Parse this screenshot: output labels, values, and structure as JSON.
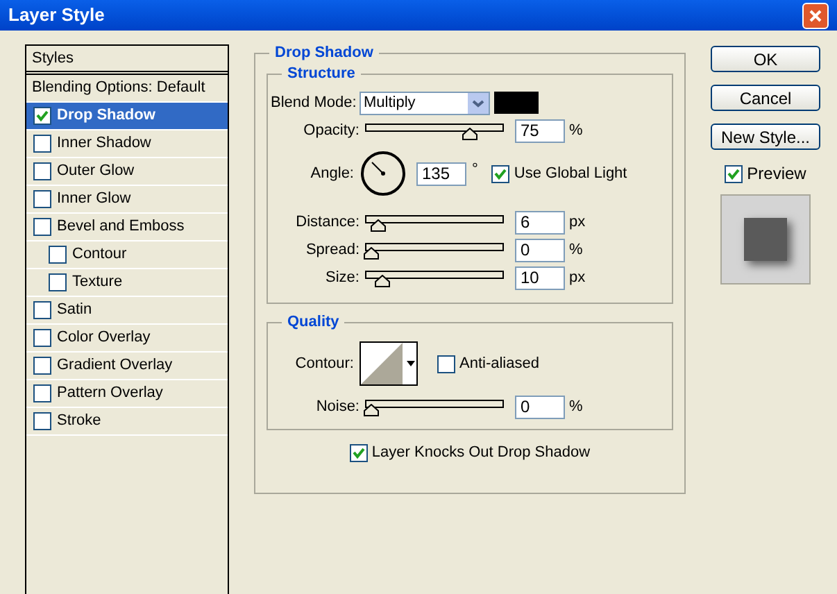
{
  "window": {
    "title": "Layer Style"
  },
  "styles_panel": {
    "header": "Styles",
    "items": [
      {
        "label": "Blending Options: Default",
        "kind": "plain",
        "selected": false
      },
      {
        "label": "Drop Shadow",
        "kind": "checkbox",
        "checked": true,
        "selected": true
      },
      {
        "label": "Inner Shadow",
        "kind": "checkbox",
        "checked": false,
        "selected": false
      },
      {
        "label": "Outer Glow",
        "kind": "checkbox",
        "checked": false,
        "selected": false
      },
      {
        "label": "Inner Glow",
        "kind": "checkbox",
        "checked": false,
        "selected": false
      },
      {
        "label": "Bevel and Emboss",
        "kind": "checkbox",
        "checked": false,
        "selected": false,
        "children": [
          {
            "label": "Contour",
            "kind": "checkbox",
            "checked": false,
            "selected": false
          },
          {
            "label": "Texture",
            "kind": "checkbox",
            "checked": false,
            "selected": false
          }
        ]
      },
      {
        "label": "Satin",
        "kind": "checkbox",
        "checked": false,
        "selected": false
      },
      {
        "label": "Color Overlay",
        "kind": "checkbox",
        "checked": false,
        "selected": false
      },
      {
        "label": "Gradient Overlay",
        "kind": "checkbox",
        "checked": false,
        "selected": false
      },
      {
        "label": "Pattern Overlay",
        "kind": "checkbox",
        "checked": false,
        "selected": false
      },
      {
        "label": "Stroke",
        "kind": "checkbox",
        "checked": false,
        "selected": false
      }
    ]
  },
  "drop_shadow": {
    "title": "Drop Shadow",
    "structure": {
      "title": "Structure",
      "blend_mode": {
        "label": "Blend Mode:",
        "value": "Multiply"
      },
      "rows": [
        {
          "kind": "slider",
          "label": "Opacity:",
          "value": "75",
          "unit": "%",
          "level": 0.77
        },
        {
          "kind": "angle",
          "label": "Angle:",
          "value": "135",
          "unit": "°",
          "use_global_light": {
            "label": "Use Global Light",
            "checked": true
          }
        },
        {
          "kind": "slider",
          "label": "Distance:",
          "value": "6",
          "unit": "px",
          "level": 0.05
        },
        {
          "kind": "slider",
          "label": "Spread:",
          "value": "0",
          "unit": "%",
          "level": 0
        },
        {
          "kind": "slider",
          "label": "Size:",
          "value": "10",
          "unit": "px",
          "level": 0.09
        }
      ]
    },
    "quality": {
      "title": "Quality",
      "contour": {
        "label": "Contour:",
        "anti_aliased": {
          "label": "Anti-aliased",
          "checked": false
        }
      },
      "noise": {
        "label": "Noise:",
        "value": "0",
        "unit": "%",
        "level": 0
      }
    },
    "knocks_out": {
      "label": "Layer Knocks Out Drop Shadow",
      "checked": true
    }
  },
  "buttons": [
    "OK",
    "Cancel",
    "New Style..."
  ],
  "preview": {
    "label": "Preview",
    "checked": true
  }
}
